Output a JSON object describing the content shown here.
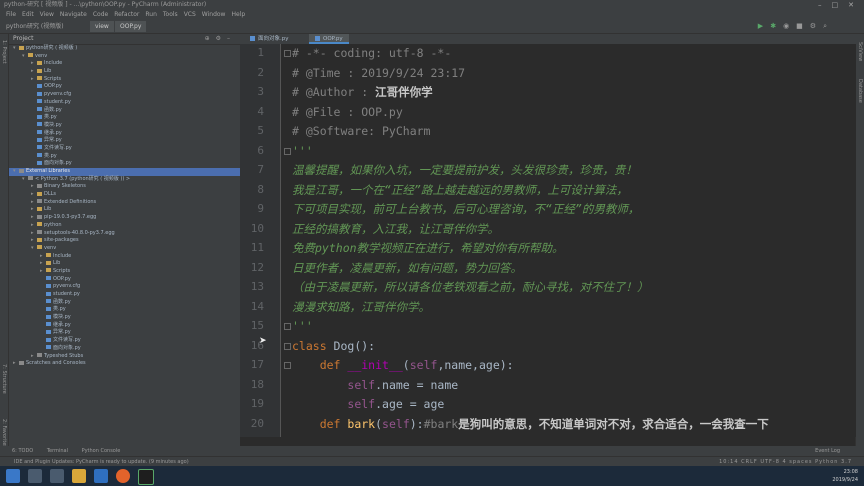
{
  "window": {
    "title": "python-研究 [ 视频版 ] - ...\\python\\OOP.py - PyCharm (Administrator)"
  },
  "menu": [
    "File",
    "Edit",
    "View",
    "Navigate",
    "Code",
    "Refactor",
    "Run",
    "Tools",
    "VCS",
    "Window",
    "Help"
  ],
  "breadcrumb": "python研究 (视频版)",
  "nav_tabs": [
    "view",
    "OOP.py"
  ],
  "project": {
    "header": "Project",
    "tree": [
      {
        "label": "python研究 ( 视频版 )",
        "indent": 0,
        "type": "folder",
        "expanded": true
      },
      {
        "label": "venv",
        "indent": 1,
        "type": "folder",
        "expanded": true
      },
      {
        "label": "Include",
        "indent": 2,
        "type": "folder"
      },
      {
        "label": "Lib",
        "indent": 2,
        "type": "folder"
      },
      {
        "label": "Scripts",
        "indent": 2,
        "type": "folder"
      },
      {
        "label": "OOP.py",
        "indent": 2,
        "type": "py"
      },
      {
        "label": "pyvenv.cfg",
        "indent": 2,
        "type": "py"
      },
      {
        "label": "student.py",
        "indent": 2,
        "type": "py"
      },
      {
        "label": "函数.py",
        "indent": 2,
        "type": "py"
      },
      {
        "label": "类.py",
        "indent": 2,
        "type": "py"
      },
      {
        "label": "模块.py",
        "indent": 2,
        "type": "py"
      },
      {
        "label": "继承.py",
        "indent": 2,
        "type": "py"
      },
      {
        "label": "异常.py",
        "indent": 2,
        "type": "py"
      },
      {
        "label": "文件读写.py",
        "indent": 2,
        "type": "py"
      },
      {
        "label": "类.py",
        "indent": 2,
        "type": "py"
      },
      {
        "label": "面向对象.py",
        "indent": 2,
        "type": "py"
      },
      {
        "label": "External Libraries",
        "indent": 0,
        "type": "lib",
        "expanded": true,
        "selected": true
      },
      {
        "label": "< Python 3.7 (python研究 ( 视频版 )) >",
        "indent": 1,
        "type": "lib",
        "expanded": true
      },
      {
        "label": "Binary Skeletons",
        "indent": 2,
        "type": "lib"
      },
      {
        "label": "DLLs",
        "indent": 2,
        "type": "folder"
      },
      {
        "label": "Extended Definitions",
        "indent": 2,
        "type": "lib"
      },
      {
        "label": "Lib",
        "indent": 2,
        "type": "folder"
      },
      {
        "label": "pip-19.0.3-py3.7.egg",
        "indent": 2,
        "type": "lib"
      },
      {
        "label": "python",
        "indent": 2,
        "type": "folder"
      },
      {
        "label": "setuptools-40.8.0-py3.7.egg",
        "indent": 2,
        "type": "lib"
      },
      {
        "label": "site-packages",
        "indent": 2,
        "type": "folder"
      },
      {
        "label": "venv",
        "indent": 2,
        "type": "folder",
        "expanded": true
      },
      {
        "label": "Include",
        "indent": 3,
        "type": "folder"
      },
      {
        "label": "Lib",
        "indent": 3,
        "type": "folder"
      },
      {
        "label": "Scripts",
        "indent": 3,
        "type": "folder"
      },
      {
        "label": "OOP.py",
        "indent": 3,
        "type": "py"
      },
      {
        "label": "pyvenv.cfg",
        "indent": 3,
        "type": "py"
      },
      {
        "label": "student.py",
        "indent": 3,
        "type": "py"
      },
      {
        "label": "函数.py",
        "indent": 3,
        "type": "py"
      },
      {
        "label": "类.py",
        "indent": 3,
        "type": "py"
      },
      {
        "label": "模块.py",
        "indent": 3,
        "type": "py"
      },
      {
        "label": "继承.py",
        "indent": 3,
        "type": "py"
      },
      {
        "label": "异常.py",
        "indent": 3,
        "type": "py"
      },
      {
        "label": "文件读写.py",
        "indent": 3,
        "type": "py"
      },
      {
        "label": "面向对象.py",
        "indent": 3,
        "type": "py"
      },
      {
        "label": "Typeshed Stubs",
        "indent": 2,
        "type": "lib"
      },
      {
        "label": "Scratches and Consoles",
        "indent": 0,
        "type": "lib"
      }
    ]
  },
  "editor_tabs": [
    {
      "label": "面向对象.py",
      "active": false
    },
    {
      "label": "OOP.py",
      "active": true
    }
  ],
  "code_lines": [
    {
      "n": "1",
      "segs": [
        [
          "cmt",
          "# -*- coding: utf-8 -*-"
        ]
      ]
    },
    {
      "n": "2",
      "segs": [
        [
          "cmt",
          "# @Time : 2019/9/24 23:17"
        ]
      ]
    },
    {
      "n": "3",
      "segs": [
        [
          "cmt",
          "# @Author : "
        ],
        [
          "bold",
          "江哥伴你学"
        ]
      ]
    },
    {
      "n": "4",
      "segs": [
        [
          "cmt",
          "# @File : OOP.py"
        ]
      ]
    },
    {
      "n": "5",
      "segs": [
        [
          "cmt",
          "# @Software: PyCharm"
        ]
      ]
    },
    {
      "n": "6",
      "segs": [
        [
          "doc",
          "'''"
        ]
      ]
    },
    {
      "n": "7",
      "segs": [
        [
          "doc",
          "温馨提醒，如果你入坑，一定要提前护发，头发很珍贵，珍贵，贵！"
        ]
      ]
    },
    {
      "n": "8",
      "segs": [
        [
          "doc",
          "我是江哥，一个在“正经”路上越走越远的男教师，上可设计算法，"
        ]
      ]
    },
    {
      "n": "9",
      "segs": [
        [
          "doc",
          "下可项目实现，前可上台教书，后可心理咨询，不“正经”的男教师，"
        ]
      ]
    },
    {
      "n": "10",
      "segs": [
        [
          "doc",
          "正经的搞教育，入江我，让江哥伴你学。"
        ]
      ]
    },
    {
      "n": "11",
      "segs": [
        [
          "doc",
          "免费python教学视频正在进行，希望对你有所帮助。"
        ]
      ]
    },
    {
      "n": "12",
      "segs": [
        [
          "doc",
          "日更作者，凌晨更新，如有问题，势力回答。"
        ]
      ]
    },
    {
      "n": "13",
      "segs": [
        [
          "doc",
          "（由于凌晨更新，所以请各位老铁观看之前，耐心寻找，对不住了！）"
        ]
      ]
    },
    {
      "n": "14",
      "segs": [
        [
          "doc",
          "漫漫求知路，江哥伴你学。"
        ]
      ]
    },
    {
      "n": "15",
      "segs": [
        [
          "doc",
          "'''"
        ]
      ]
    },
    {
      "n": "16",
      "segs": [
        [
          "kw",
          "class "
        ],
        [
          "txt",
          "Dog():"
        ]
      ]
    },
    {
      "n": "17",
      "segs": [
        [
          "txt",
          "    "
        ],
        [
          "kw",
          "def "
        ],
        [
          "mg",
          "__init__"
        ],
        [
          "txt",
          "("
        ],
        [
          "sf",
          "self"
        ],
        [
          "txt",
          ",name,age):"
        ]
      ]
    },
    {
      "n": "18",
      "segs": [
        [
          "txt",
          "        "
        ],
        [
          "sf",
          "self"
        ],
        [
          "txt",
          ".name = name"
        ]
      ]
    },
    {
      "n": "19",
      "segs": [
        [
          "txt",
          "        "
        ],
        [
          "sf",
          "self"
        ],
        [
          "txt",
          ".age = age"
        ]
      ]
    },
    {
      "n": "20",
      "segs": [
        [
          "txt",
          "    "
        ],
        [
          "kw",
          "def "
        ],
        [
          "fn",
          "bark"
        ],
        [
          "txt",
          "("
        ],
        [
          "sf",
          "self"
        ],
        [
          "txt",
          "):"
        ],
        [
          "cmt",
          "#bark"
        ],
        [
          "bold",
          "是狗叫的意思，不知道单词对不对，求合适合，一会我查一下"
        ]
      ]
    }
  ],
  "bottom_tabs": [
    "6: TODO",
    "Terminal",
    "Python Console"
  ],
  "status": {
    "message": "IDE and Plugin Updates: PyCharm is ready to update. (9 minutes ago)",
    "right": "10:14  CRLF  UTF-8  4 spaces  Python 3.7"
  },
  "event_log": "Event Log",
  "clock": {
    "time": "23:08",
    "date": "2019/9/24"
  }
}
